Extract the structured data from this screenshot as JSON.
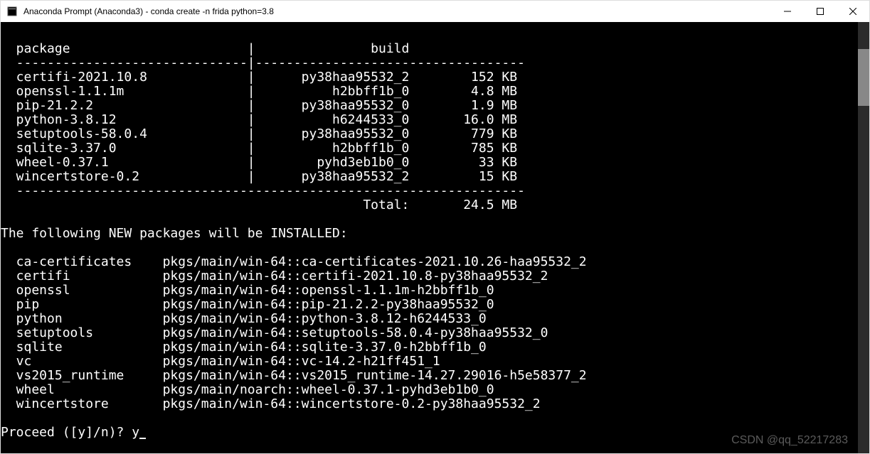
{
  "window": {
    "title": "Anaconda Prompt (Anaconda3) - conda  create -n frida python=3.8"
  },
  "table": {
    "header": {
      "package": "package",
      "build": "build"
    },
    "rows": [
      {
        "package": "certifi-2021.10.8",
        "build": "py38haa95532_2",
        "size": "152 KB"
      },
      {
        "package": "openssl-1.1.1m",
        "build": "h2bbff1b_0",
        "size": "4.8 MB"
      },
      {
        "package": "pip-21.2.2",
        "build": "py38haa95532_0",
        "size": "1.9 MB"
      },
      {
        "package": "python-3.8.12",
        "build": "h6244533_0",
        "size": "16.0 MB"
      },
      {
        "package": "setuptools-58.0.4",
        "build": "py38haa95532_0",
        "size": "779 KB"
      },
      {
        "package": "sqlite-3.37.0",
        "build": "h2bbff1b_0",
        "size": "785 KB"
      },
      {
        "package": "wheel-0.37.1",
        "build": "pyhd3eb1b0_0",
        "size": "33 KB"
      },
      {
        "package": "wincertstore-0.2",
        "build": "py38haa95532_2",
        "size": "15 KB"
      }
    ],
    "total_label": "Total:",
    "total_value": "24.5 MB"
  },
  "install_heading": "The following NEW packages will be INSTALLED:",
  "install_rows": [
    {
      "name": "ca-certificates",
      "spec": "pkgs/main/win-64::ca-certificates-2021.10.26-haa95532_2"
    },
    {
      "name": "certifi",
      "spec": "pkgs/main/win-64::certifi-2021.10.8-py38haa95532_2"
    },
    {
      "name": "openssl",
      "spec": "pkgs/main/win-64::openssl-1.1.1m-h2bbff1b_0"
    },
    {
      "name": "pip",
      "spec": "pkgs/main/win-64::pip-21.2.2-py38haa95532_0"
    },
    {
      "name": "python",
      "spec": "pkgs/main/win-64::python-3.8.12-h6244533_0"
    },
    {
      "name": "setuptools",
      "spec": "pkgs/main/win-64::setuptools-58.0.4-py38haa95532_0"
    },
    {
      "name": "sqlite",
      "spec": "pkgs/main/win-64::sqlite-3.37.0-h2bbff1b_0"
    },
    {
      "name": "vc",
      "spec": "pkgs/main/win-64::vc-14.2-h21ff451_1"
    },
    {
      "name": "vs2015_runtime",
      "spec": "pkgs/main/win-64::vs2015_runtime-14.27.29016-h5e58377_2"
    },
    {
      "name": "wheel",
      "spec": "pkgs/main/noarch::wheel-0.37.1-pyhd3eb1b0_0"
    },
    {
      "name": "wincertstore",
      "spec": "pkgs/main/win-64::wincertstore-0.2-py38haa95532_2"
    }
  ],
  "prompt": {
    "text": "Proceed ([y]/n)? ",
    "input": "y"
  },
  "watermark": "CSDN @qq_52217283"
}
